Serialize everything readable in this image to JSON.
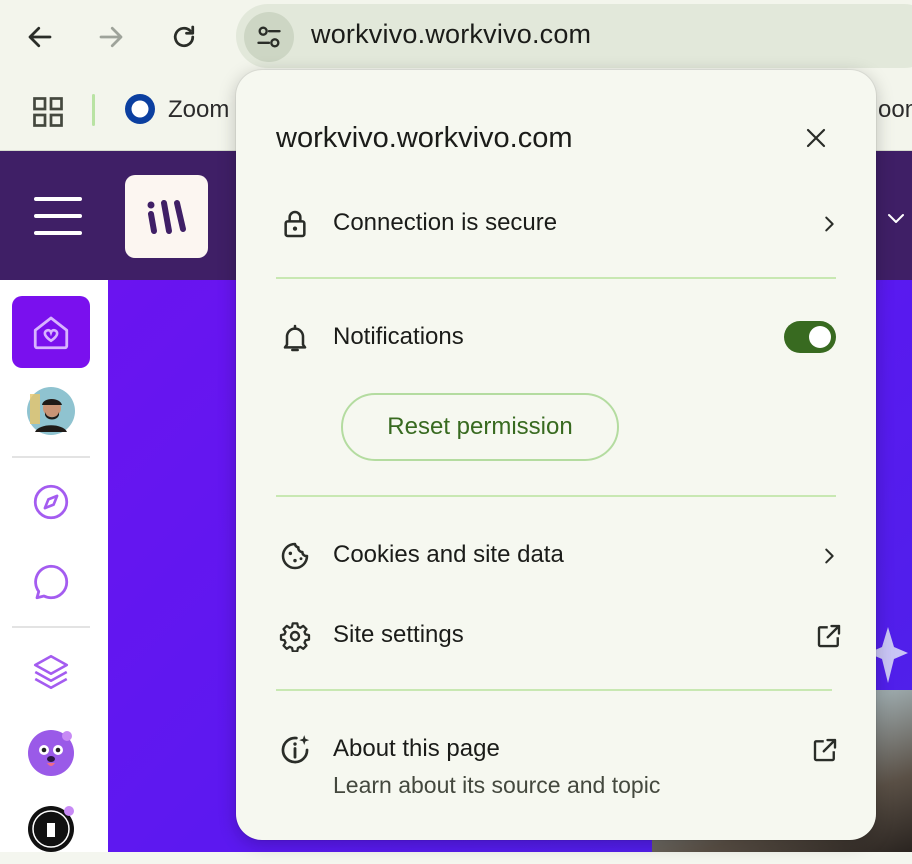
{
  "browser": {
    "url": "workvivo.workvivo.com",
    "bookmarks": [
      {
        "label": "Zoom",
        "icon": "zoom-logo-icon"
      },
      {
        "label": "oom",
        "icon": ""
      }
    ]
  },
  "popup": {
    "title": "workvivo.workvivo.com",
    "connection_label": "Connection is secure",
    "notifications_label": "Notifications",
    "notifications_enabled": true,
    "reset_label": "Reset permission",
    "cookies_label": "Cookies and site data",
    "site_settings_label": "Site settings",
    "about_label": "About this page",
    "about_sub": "Learn about its source and topic"
  },
  "colors": {
    "header_bg": "#3f1f66",
    "sidebar_active": "#7a10ee",
    "hero": "#5a19f0",
    "toggle_on": "#386a20",
    "separator": "#c8e8b2",
    "popup_bg": "#f6f8f0"
  }
}
